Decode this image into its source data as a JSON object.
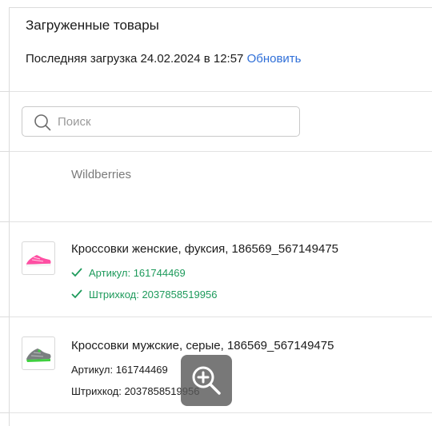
{
  "panel": {
    "title": "Загруженные товары",
    "last_upload_label": "Последняя загрузка 24.02.2024 в 12:57",
    "refresh_link": "Обновить"
  },
  "search": {
    "placeholder": "Поиск",
    "icon": "search-icon"
  },
  "marketplace": "Wildberries",
  "products": [
    {
      "name": "Кроссовки женские, фуксия, 186569_567149475",
      "article": "Артикул: 161744469",
      "barcode": "Штрихкод: 2037858519956",
      "verified": true,
      "thumb_color": "#ff4fa3"
    },
    {
      "name": "Кроссовки мужские, серые, 186569_567149475",
      "article": "Артикул: 161744469",
      "barcode": "Штрихкод: 2037858519956",
      "verified": false,
      "thumb_color": "#7a7f80"
    }
  ],
  "zoom": {
    "icon": "zoom-in-icon"
  },
  "colors": {
    "link": "#2f6fd8",
    "success": "#1d9a5b",
    "muted": "#7a7a7a"
  }
}
